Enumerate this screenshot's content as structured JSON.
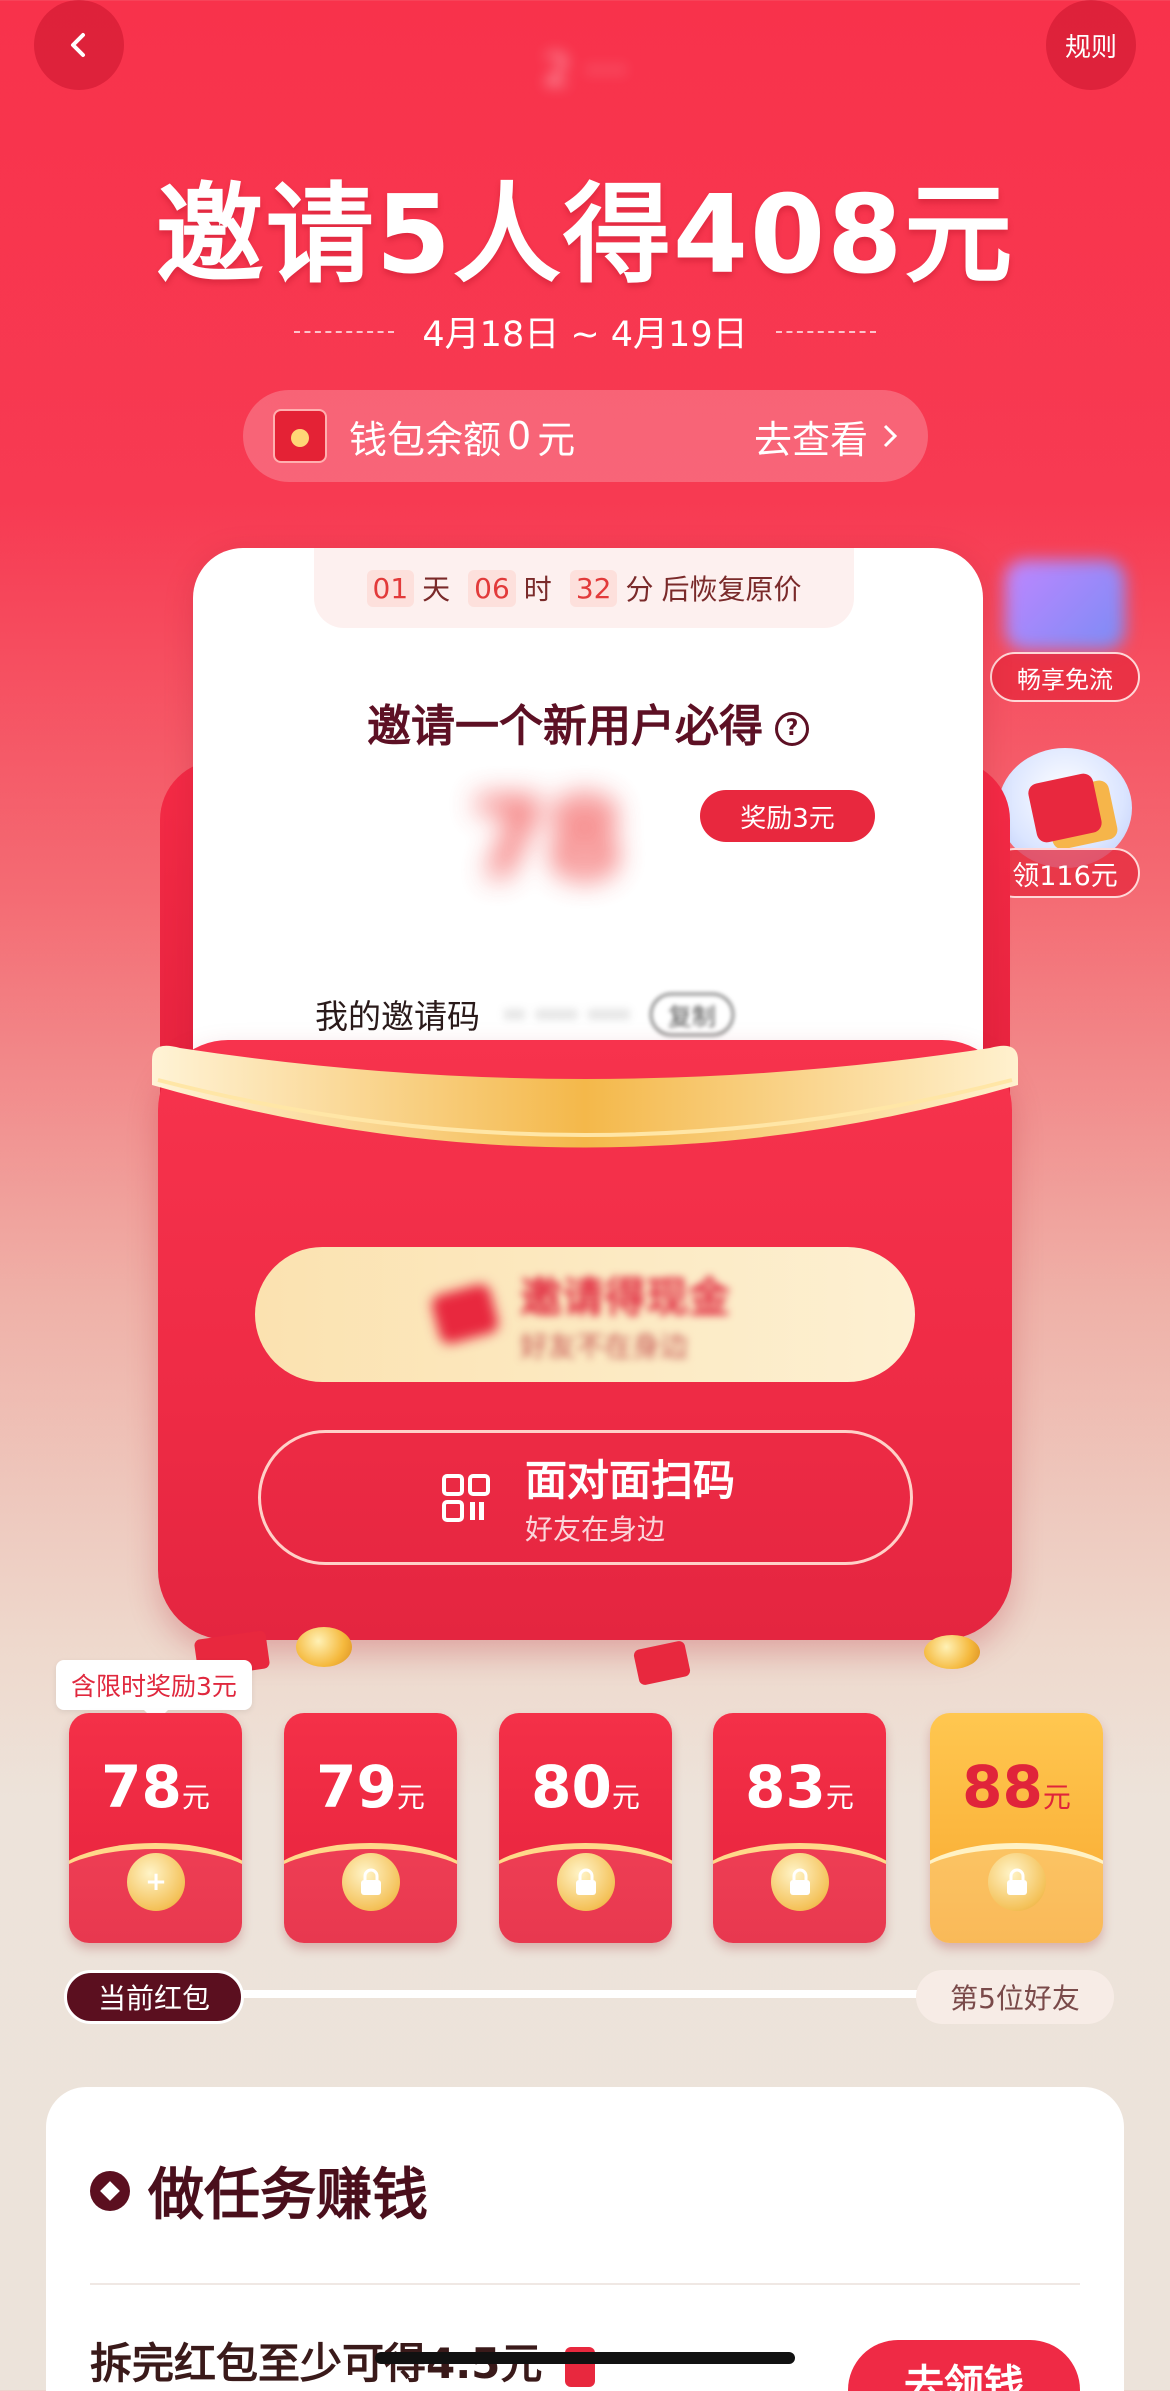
{
  "header": {
    "back_icon": "chevron-left-icon",
    "brand_text": "2 ···",
    "rules_label": "规则"
  },
  "hero": {
    "title": "邀请5人得408元",
    "date_range": "4月18日 ~ 4月19日"
  },
  "wallet": {
    "label": "钱包余额",
    "balance": "0",
    "unit": "元",
    "cta": "去查看"
  },
  "side": {
    "flow_label": "畅享免流",
    "cash_label": "领116元"
  },
  "invite_card": {
    "countdown": {
      "days": "01",
      "days_unit": "天",
      "hours": "06",
      "hours_unit": "时",
      "minutes": "32",
      "minutes_unit": "分",
      "suffix": "后恢复原价"
    },
    "heading": "邀请一个新用户必得",
    "amount_blurred": "78",
    "reward_badge": "奖励3元",
    "code_label": "我的邀请码",
    "code_value": "·· ···· ····",
    "copy_label": "复制"
  },
  "actions": {
    "cash_title": "邀请得现金",
    "cash_subtitle": "好友不在身边",
    "scan_title": "面对面扫码",
    "scan_subtitle": "好友在身边"
  },
  "tiers": {
    "bonus_tag": "含限时奖励3元",
    "unit": "元",
    "items": [
      {
        "amount": "78",
        "state": "unlocked",
        "symbol": "+"
      },
      {
        "amount": "79",
        "state": "locked",
        "symbol": "🔒"
      },
      {
        "amount": "80",
        "state": "locked",
        "symbol": "🔒"
      },
      {
        "amount": "83",
        "state": "locked",
        "symbol": "🔒"
      },
      {
        "amount": "88",
        "state": "locked",
        "symbol": "🔒"
      }
    ],
    "current_label": "当前红包",
    "end_label": "第5位好友"
  },
  "tasks": {
    "title": "做任务赚钱",
    "item1_text": "拆完红包至少可得4.5元",
    "item1_button": "去领钱"
  },
  "colors": {
    "primary_red": "#f8324b",
    "dark_maroon": "#5b0f1f",
    "gold": "#f8a82f"
  }
}
